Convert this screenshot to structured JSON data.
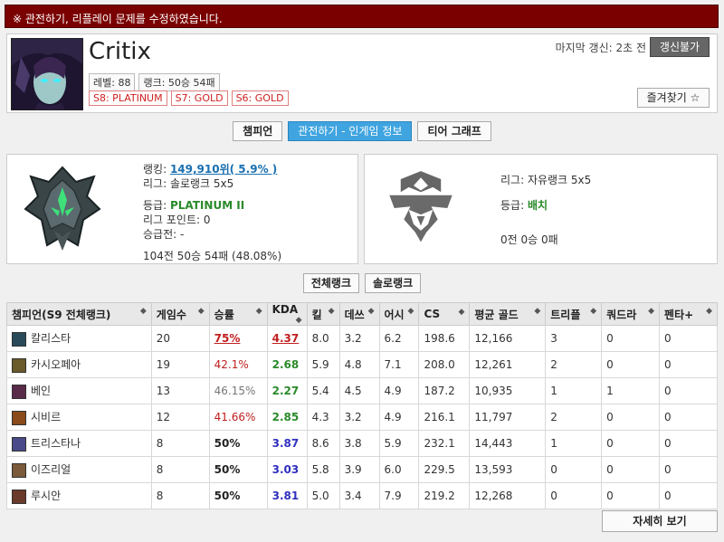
{
  "notice": "※ 관전하기, 리플레이 문제를 수정하였습니다.",
  "profile": {
    "name": "Critix",
    "level": "레벨: 88",
    "rank": "랭크: 50승 54패",
    "seasons": [
      "S8: PLATINUM",
      "S7: GOLD",
      "S6: GOLD"
    ],
    "last_update": "마지막 갱신: 2초 전",
    "update_btn": "갱신불가",
    "favorite_btn": "즐겨찾기 ☆"
  },
  "tabs": [
    "챔피언",
    "관전하기 - 인게임 정보",
    "티어 그래프"
  ],
  "solo": {
    "ranking_label": "랭킹: ",
    "ranking_value": "149,910위( 5.9% )",
    "league": "리그: 솔로랭크 5x5",
    "tier_label": "등급: ",
    "tier_value": "PLATINUM II",
    "lp": "리그 포인트: 0",
    "promo": "승급전: -",
    "record": "104전 50승 54패 (48.08%)"
  },
  "flex": {
    "league": "리그: 자유랭크 5x5",
    "tier_label": "등급: ",
    "tier_value": "배치",
    "record": "0전 0승 0패"
  },
  "filters": [
    "전체랭크",
    "솔로랭크"
  ],
  "table": {
    "headers": [
      "챔피언(S9 전체랭크)",
      "게임수",
      "승률",
      "KDA",
      "킬",
      "데쓰",
      "어시",
      "CS",
      "평균 골드",
      "트리플",
      "쿼드라",
      "펜타+"
    ],
    "rows": [
      {
        "champ": "칼리스타",
        "icon_color": "#2a4a5a",
        "games": "20",
        "wr": "75%",
        "wr_style": "wr-red-ul",
        "kda": "4.37",
        "kda_style": "kda-red",
        "k": "8.0",
        "d": "3.2",
        "a": "6.2",
        "cs": "198.6",
        "gold": "12,166",
        "triple": "3",
        "quadra": "0",
        "penta": "0"
      },
      {
        "champ": "카시오페아",
        "icon_color": "#6a5a2a",
        "games": "19",
        "wr": "42.1%",
        "wr_style": "wr-red",
        "kda": "2.68",
        "kda_style": "kda-green",
        "k": "5.9",
        "d": "4.8",
        "a": "7.1",
        "cs": "208.0",
        "gold": "12,261",
        "triple": "2",
        "quadra": "0",
        "penta": "0"
      },
      {
        "champ": "베인",
        "icon_color": "#5a2a4a",
        "games": "13",
        "wr": "46.15%",
        "wr_style": "wr-gray",
        "kda": "2.27",
        "kda_style": "kda-green",
        "k": "5.4",
        "d": "4.5",
        "a": "4.9",
        "cs": "187.2",
        "gold": "10,935",
        "triple": "1",
        "quadra": "1",
        "penta": "0"
      },
      {
        "champ": "시비르",
        "icon_color": "#8a4a1a",
        "games": "12",
        "wr": "41.66%",
        "wr_style": "wr-red",
        "kda": "2.85",
        "kda_style": "kda-green",
        "k": "4.3",
        "d": "3.2",
        "a": "4.9",
        "cs": "216.1",
        "gold": "11,797",
        "triple": "2",
        "quadra": "0",
        "penta": "0"
      },
      {
        "champ": "트리스타나",
        "icon_color": "#4a4a8a",
        "games": "8",
        "wr": "50%",
        "wr_style": "wr-bold",
        "kda": "3.87",
        "kda_style": "kda-blue",
        "k": "8.6",
        "d": "3.8",
        "a": "5.9",
        "cs": "232.1",
        "gold": "14,443",
        "triple": "1",
        "quadra": "0",
        "penta": "0"
      },
      {
        "champ": "이즈리얼",
        "icon_color": "#7a5a3a",
        "games": "8",
        "wr": "50%",
        "wr_style": "wr-bold",
        "kda": "3.03",
        "kda_style": "kda-blue",
        "k": "5.8",
        "d": "3.9",
        "a": "6.0",
        "cs": "229.5",
        "gold": "13,593",
        "triple": "0",
        "quadra": "0",
        "penta": "0"
      },
      {
        "champ": "루시안",
        "icon_color": "#6a3a2a",
        "games": "8",
        "wr": "50%",
        "wr_style": "wr-bold",
        "kda": "3.81",
        "kda_style": "kda-blue",
        "k": "5.0",
        "d": "3.4",
        "a": "7.9",
        "cs": "219.2",
        "gold": "12,268",
        "triple": "0",
        "quadra": "0",
        "penta": "0"
      }
    ]
  },
  "more_btn": "자세히 보기"
}
